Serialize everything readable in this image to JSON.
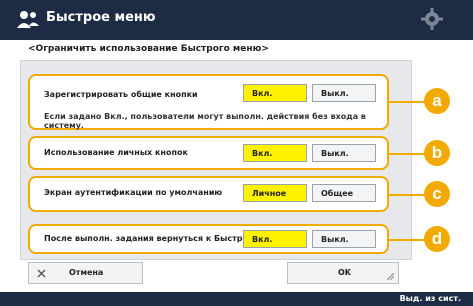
{
  "header": {
    "title": "Быстрое меню"
  },
  "subtitle": "<Ограничить использование Быстрого меню>",
  "rows": [
    {
      "label": "Зарегистрировать общие кнопки",
      "on_label": "Вкл.",
      "off_label": "Выкл.",
      "note": "Если задано Вкл., пользователи могут выполн. действия без входа в систему.",
      "callout": "a"
    },
    {
      "label": "Использование личных кнопок",
      "on_label": "Вкл.",
      "off_label": "Выкл.",
      "callout": "b"
    },
    {
      "label": "Экран аутентификации по умолчанию",
      "on_label": "Личное",
      "off_label": "Общее",
      "callout": "c"
    },
    {
      "label": "После выполн. задания вернуться к Быстрому меню",
      "on_label": "Вкл.",
      "off_label": "Выкл.",
      "callout": "d"
    }
  ],
  "footer_buttons": {
    "cancel": "Отмена",
    "ok": "OK"
  },
  "status_bar": {
    "text": "Выд. из сист."
  },
  "colors": {
    "title_bar": "#1d2c44",
    "selected": "#fff200",
    "callout": "#f2a900"
  }
}
